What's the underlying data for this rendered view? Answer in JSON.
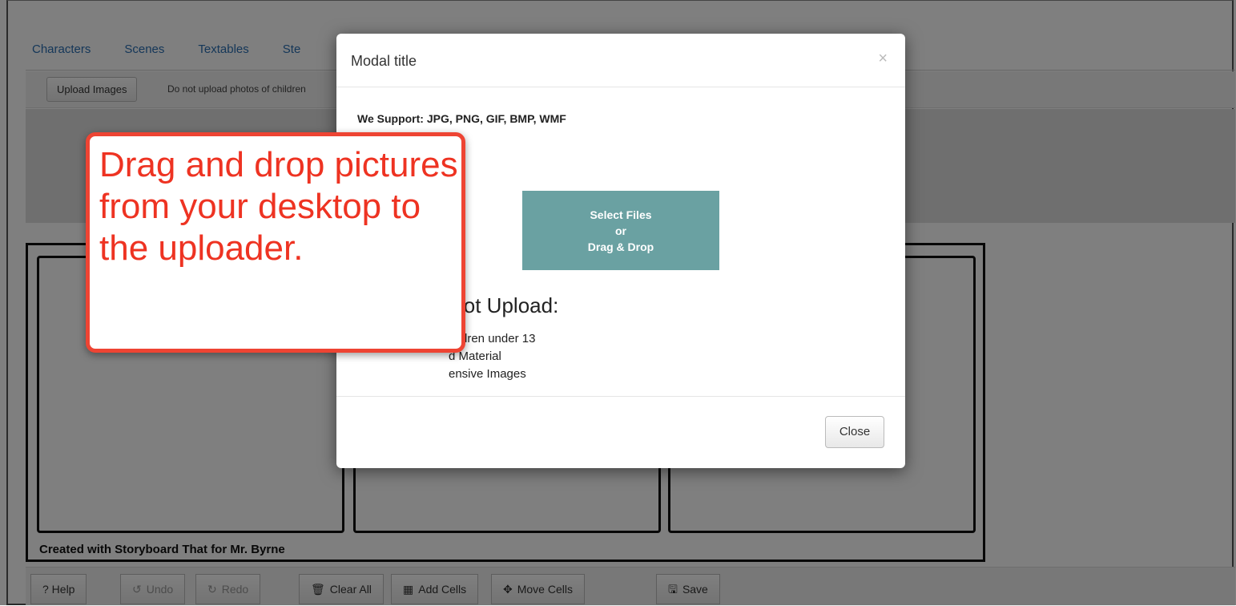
{
  "tabs": [
    "Characters",
    "Scenes",
    "Textables",
    "Ste"
  ],
  "upload_bar": {
    "button_label": "Upload Images",
    "note": "Do not upload photos of children"
  },
  "storyboard": {
    "credit": "Created with Storyboard That for Mr. Byrne"
  },
  "toolbar": {
    "help": "? Help",
    "undo": "Undo",
    "redo": "Redo",
    "clear_all": "Clear All",
    "add_cells": "Add Cells",
    "move_cells": "Move Cells",
    "save": "Save"
  },
  "modal": {
    "title": "Modal title",
    "close_x": "×",
    "support_text": "We Support: JPG, PNG, GIF, BMP, WMF",
    "dropzone_line1": "Select Files",
    "dropzone_line2": "or",
    "dropzone_line3": "Drag & Drop",
    "do_not_title": "Not Upload:",
    "rules": [
      "hildren under 13",
      "d Material",
      "ensive Images"
    ],
    "close_button": "Close"
  },
  "callout": {
    "text": "Drag and drop pictures from your desktop to the uploader."
  }
}
